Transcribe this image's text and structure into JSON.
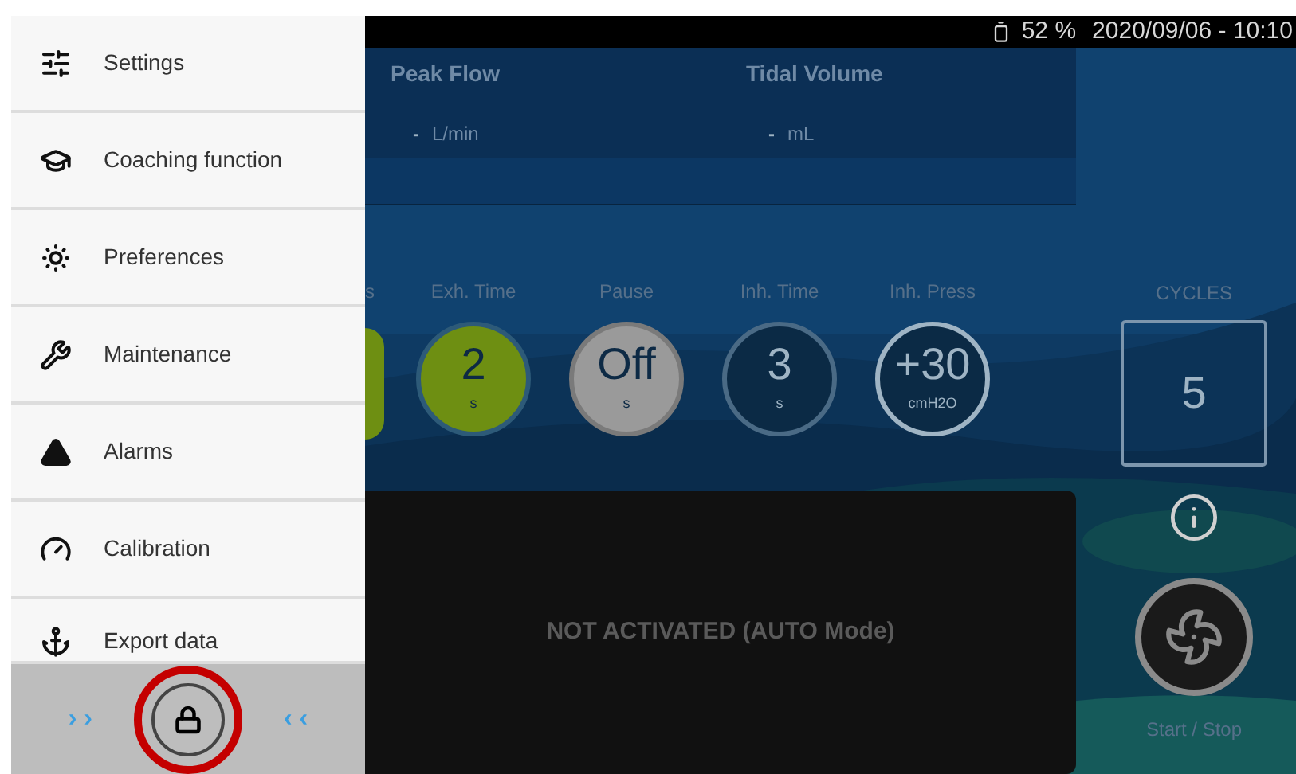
{
  "menu": {
    "items": [
      {
        "label": "Settings"
      },
      {
        "label": "Coaching function"
      },
      {
        "label": "Preferences"
      },
      {
        "label": "Maintenance"
      },
      {
        "label": "Alarms"
      },
      {
        "label": "Calibration"
      },
      {
        "label": "Export data"
      }
    ],
    "footer": {
      "left": "› ›",
      "right": "‹ ‹",
      "lock_highlighted": true
    }
  },
  "status_bar": {
    "battery": "52 %",
    "datetime": "2020/09/06 - 10:10"
  },
  "metrics": [
    {
      "label": "Peak Flow",
      "value": "-",
      "unit": "L/min"
    },
    {
      "label": "Tidal Volume",
      "value": "-",
      "unit": "mL"
    }
  ],
  "params": [
    {
      "kind": "partial",
      "label": "s"
    },
    {
      "kind": "active",
      "label": "Exh. Time",
      "value": "2",
      "unit": "s"
    },
    {
      "kind": "off",
      "label": "Pause",
      "value": "Off",
      "unit": "s"
    },
    {
      "kind": "dark",
      "label": "Inh. Time",
      "value": "3",
      "unit": "s"
    },
    {
      "kind": "outline",
      "label": "Inh. Press",
      "value": "+30",
      "unit": "cmH2O"
    }
  ],
  "message": "NOT ACTIVATED (AUTO Mode)",
  "cycles": {
    "label": "CYCLES",
    "value": "5"
  },
  "start_stop": "Start / Stop"
}
